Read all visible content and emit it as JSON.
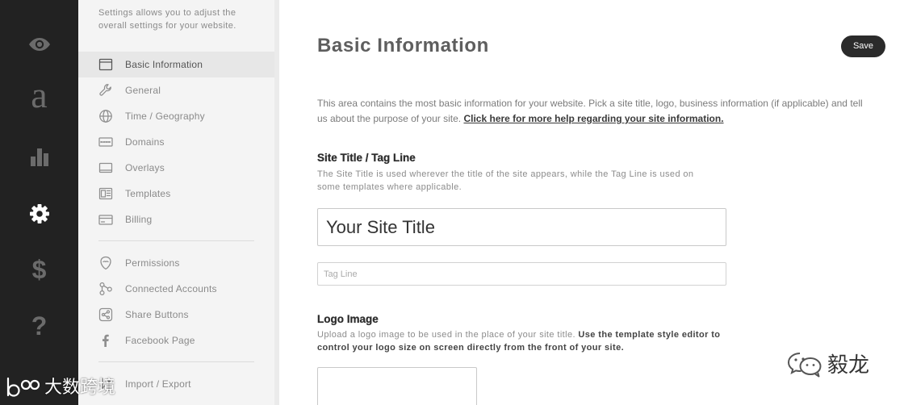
{
  "theme": {
    "rail_bg": "#222222",
    "rail_icon": "#6b6b6b",
    "rail_icon_active": "#ffffff",
    "panel_bg": "#f4f4f4",
    "active_row_bg": "#e7e7e7",
    "button_bg": "#2b2b2b",
    "button_text": "#ffffff"
  },
  "rail": {
    "items": [
      {
        "icon": "eye-icon"
      },
      {
        "icon": "letter-a-icon",
        "glyph": "a"
      },
      {
        "icon": "bar-chart-icon"
      },
      {
        "icon": "gear-icon",
        "active": true
      },
      {
        "icon": "dollar-icon",
        "glyph": "$"
      },
      {
        "icon": "question-icon",
        "glyph": "?"
      }
    ]
  },
  "sidebar": {
    "description": "Settings allows you to adjust the overall settings for your website.",
    "items": [
      {
        "label": "Basic Information",
        "icon": "window-icon",
        "active": true
      },
      {
        "label": "General",
        "icon": "wrench-icon"
      },
      {
        "label": "Time / Geography",
        "icon": "globe-icon"
      },
      {
        "label": "Domains",
        "icon": "domain-icon"
      },
      {
        "label": "Overlays",
        "icon": "overlay-icon"
      },
      {
        "label": "Templates",
        "icon": "template-icon"
      },
      {
        "label": "Billing",
        "icon": "credit-card-icon"
      },
      {
        "label": "Permissions",
        "icon": "shield-icon"
      },
      {
        "label": "Connected Accounts",
        "icon": "connected-nodes-icon"
      },
      {
        "label": "Share Buttons",
        "icon": "share-icon"
      },
      {
        "label": "Facebook Page",
        "icon": "facebook-icon"
      },
      {
        "label": "Import / Export",
        "icon": "import-export-icon"
      }
    ]
  },
  "main": {
    "title": "Basic Information",
    "save_label": "Save",
    "intro": "This area contains the most basic information for your website. Pick a site title, logo, business information (if applicable) and tell us about the purpose of your site.",
    "help_link": "Click here for more help regarding your site information.",
    "site_title_section": {
      "heading": "Site Title / Tag Line",
      "description": "The Site Title is used wherever the title of the site appears, while the Tag Line is used on some templates where applicable.",
      "title_value": "Your Site Title",
      "tagline_placeholder": "Tag Line"
    },
    "logo_section": {
      "heading": "Logo Image",
      "description": "Upload a logo image to be used in the place of your site title.",
      "description_bold": "Use the template style editor to control your logo size on screen directly from the front of your site."
    }
  },
  "watermarks": {
    "bottom_left": "大数跨境",
    "bottom_right": "毅龙"
  }
}
